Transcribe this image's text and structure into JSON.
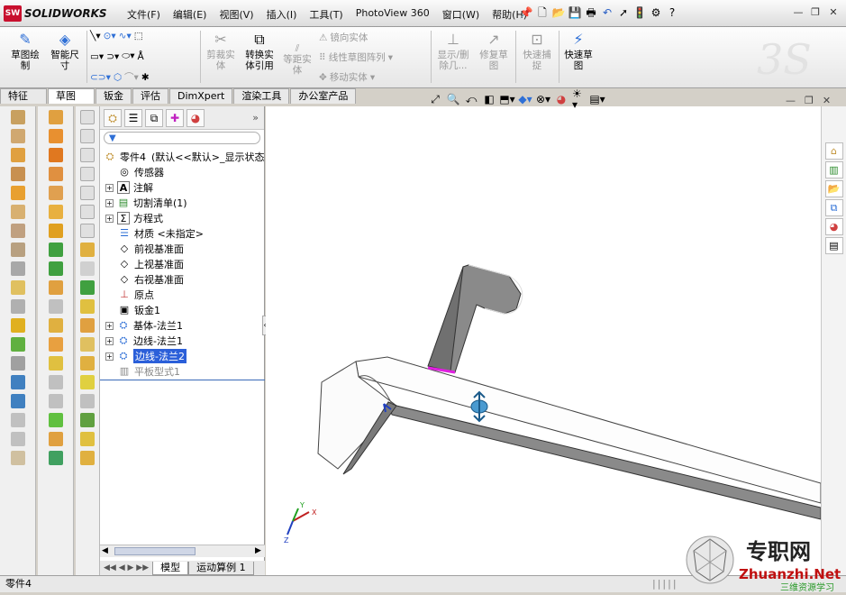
{
  "app": {
    "logo_badge": "SW",
    "logo_text": "SOLIDWORKS"
  },
  "menu": [
    "文件(F)",
    "编辑(E)",
    "视图(V)",
    "插入(I)",
    "工具(T)",
    "PhotoView 360",
    "窗口(W)",
    "帮助(H)"
  ],
  "commands": {
    "sketch": "草图绘制",
    "smart_dim": "智能尺寸",
    "trim": "剪裁实体",
    "convert": "转换实体引用",
    "offset": "等距实体",
    "mirror": "镜向实体",
    "linear_pattern": "线性草图阵列",
    "move": "移动实体",
    "show_delete": "显示/删除几...",
    "repair": "修复草图",
    "quick_snap": "快速捕捉",
    "rapid_sketch": "快速草图"
  },
  "tabs": [
    "特征",
    "草图",
    "钣金",
    "评估",
    "DimXpert",
    "渲染工具",
    "办公室产品"
  ],
  "active_tab": "草图",
  "tree": {
    "part": "零件4",
    "config": "(默认<<默认>_显示状态",
    "items": [
      "传感器",
      "注解",
      "切割清单(1)",
      "方程式",
      "材质 <未指定>",
      "前视基准面",
      "上视基准面",
      "右视基准面",
      "原点",
      "钣金1",
      "基体-法兰1",
      "边线-法兰1",
      "边线-法兰2",
      "平板型式1"
    ]
  },
  "bottom_tabs": [
    "模型",
    "运动算例 1"
  ],
  "status_text": "零件4",
  "axis": {
    "x": "X",
    "y": "Y",
    "z": "Z"
  },
  "watermark": {
    "cn": "专职网",
    "en": "Zhuanzhi.Net",
    "sub": "三维资源学习"
  },
  "colors": {
    "accent": "#c8102e",
    "highlight": "#2b5fd9",
    "edge_pink": "#e020e0",
    "part_gray": "#8a8a8a"
  }
}
